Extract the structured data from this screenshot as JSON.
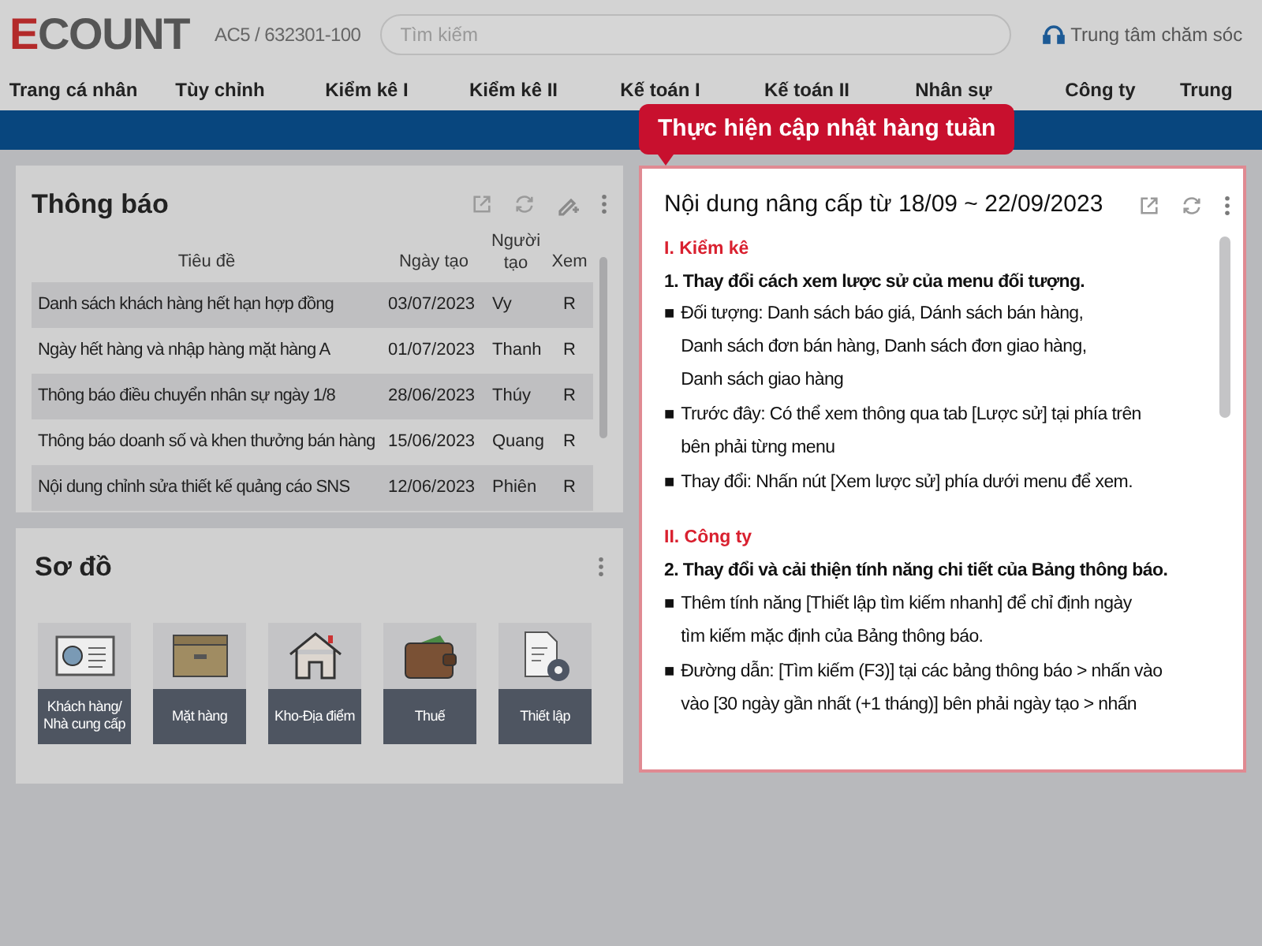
{
  "header": {
    "logo": "ECOUNT",
    "account": "AC5 / 632301-100",
    "search": {
      "placeholder": "Tìm kiếm"
    },
    "support": "Trung tâm chăm sóc"
  },
  "nav": [
    "Trang cá nhân",
    "Tùy chỉnh",
    "Kiểm kê I",
    "Kiểm kê II",
    "Kế toán I",
    "Kế toán II",
    "Nhân sự",
    "Công ty",
    "Trung"
  ],
  "tooltip": "Thực hiện cập nhật hàng tuần",
  "notice_panel": {
    "title": "Thông báo",
    "columns": [
      "Tiêu đề",
      "Ngày tạo",
      "Người tạo",
      "Xem"
    ],
    "rows": [
      [
        "Danh sách khách hàng hết hạn hợp đồng",
        "03/07/2023",
        "Vy",
        "R"
      ],
      [
        "Ngày hết hàng và nhập hàng mặt hàng A",
        "01/07/2023",
        "Thanh",
        "R"
      ],
      [
        "Thông báo điều chuyển nhân sự ngày 1/8",
        "28/06/2023",
        "Thúy",
        "R"
      ],
      [
        "Thông báo doanh số và khen thưởng bán hàng",
        "15/06/2023",
        "Quang",
        "R"
      ],
      [
        "Nội dung chỉnh sửa thiết kế quảng cáo SNS",
        "12/06/2023",
        "Phiên",
        "R"
      ]
    ]
  },
  "diagram_panel": {
    "title": "Sơ đồ",
    "tiles": [
      {
        "kind": "card",
        "label": "Khách hàng/ Nhà cung cấp"
      },
      {
        "kind": "box",
        "label": "Mặt hàng"
      },
      {
        "kind": "house",
        "label": "Kho-Địa điểm"
      },
      {
        "kind": "wallet",
        "label": "Thuế"
      },
      {
        "kind": "settings",
        "label": "Thiết lập"
      }
    ]
  },
  "update_panel": {
    "title": "Nội dung nâng cấp từ 18/09 ~ 22/09/2023",
    "items": [
      {
        "kind": "section",
        "text": "I. Kiểm kê"
      },
      {
        "kind": "heading",
        "text": "1. Thay đổi cách xem lược sử của menu đối tượng."
      },
      {
        "kind": "bullet",
        "marker": "■",
        "lines": [
          "Đối tượng: Danh sách báo giá, Dánh sách bán hàng,",
          "Danh sách đơn bán hàng, Danh sách đơn giao hàng,",
          "Danh sách giao hàng"
        ]
      },
      {
        "kind": "bullet",
        "marker": "■",
        "lines": [
          "Trước đây: Có thể xem thông qua tab [Lược sử] tại phía trên",
          "bên phải từng menu"
        ]
      },
      {
        "kind": "bullet",
        "marker": "■",
        "lines": [
          "Thay đổi: Nhấn nút [Xem lược sử] phía dưới menu để xem."
        ]
      },
      {
        "kind": "section",
        "text": "II. Công ty"
      },
      {
        "kind": "heading",
        "text": "2. Thay đổi và cải thiện tính năng chi tiết của Bảng thông báo."
      },
      {
        "kind": "bullet",
        "marker": "■",
        "lines": [
          "Thêm tính năng [Thiết lập tìm kiếm nhanh] để chỉ định ngày",
          "tìm kiếm mặc định của Bảng thông báo."
        ]
      },
      {
        "kind": "bullet",
        "marker": "■",
        "lines": [
          "Đường dẫn: [Tìm kiếm (F3)] tại các bảng thông báo > nhấn vào",
          "vào [30 ngày gần nhất (+1 tháng)] bên phải ngày tạo > nhấn"
        ]
      }
    ]
  }
}
